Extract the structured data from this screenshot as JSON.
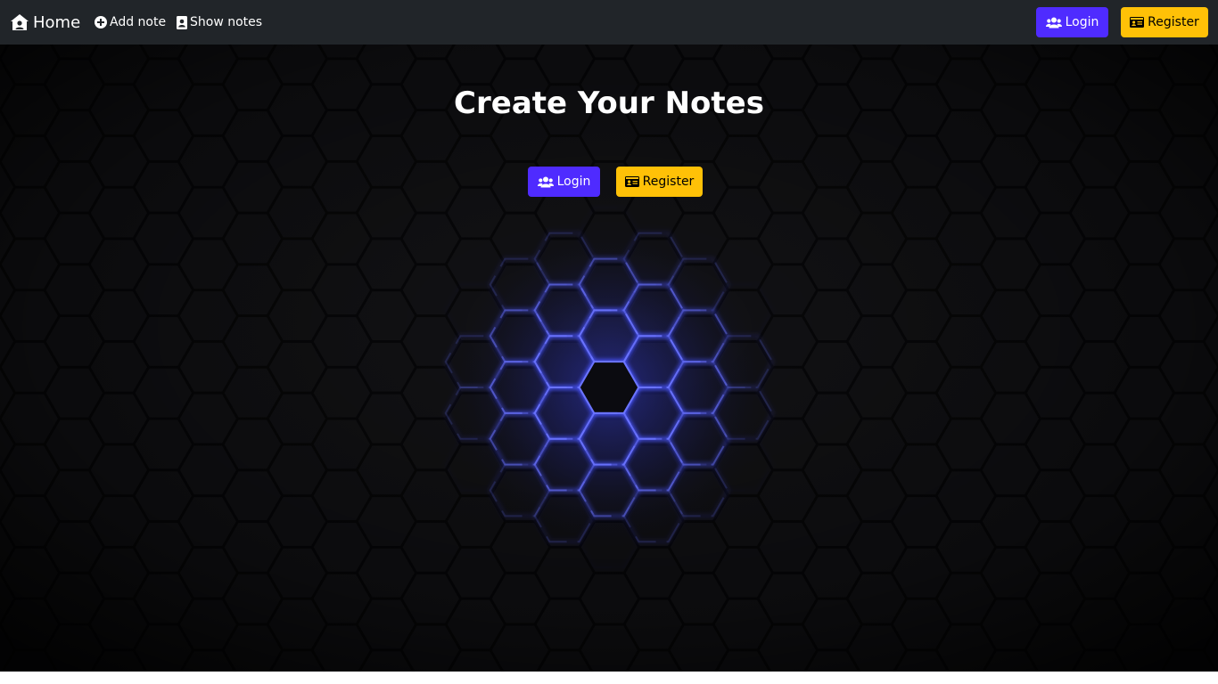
{
  "navbar": {
    "brand_label": "Home",
    "brand_icon": "house-user-icon",
    "links": [
      {
        "label": "Add note",
        "icon": "plus-circle-icon"
      },
      {
        "label": "Show notes",
        "icon": "address-book-icon"
      }
    ],
    "login_label": "Login",
    "register_label": "Register"
  },
  "hero": {
    "title": "Create Your Notes",
    "login_label": "Login",
    "register_label": "Register",
    "glow_color": "#4a55ff"
  },
  "colors": {
    "navbar_bg": "#212529",
    "primary": "#4f2bff",
    "warning": "#ffc107"
  }
}
